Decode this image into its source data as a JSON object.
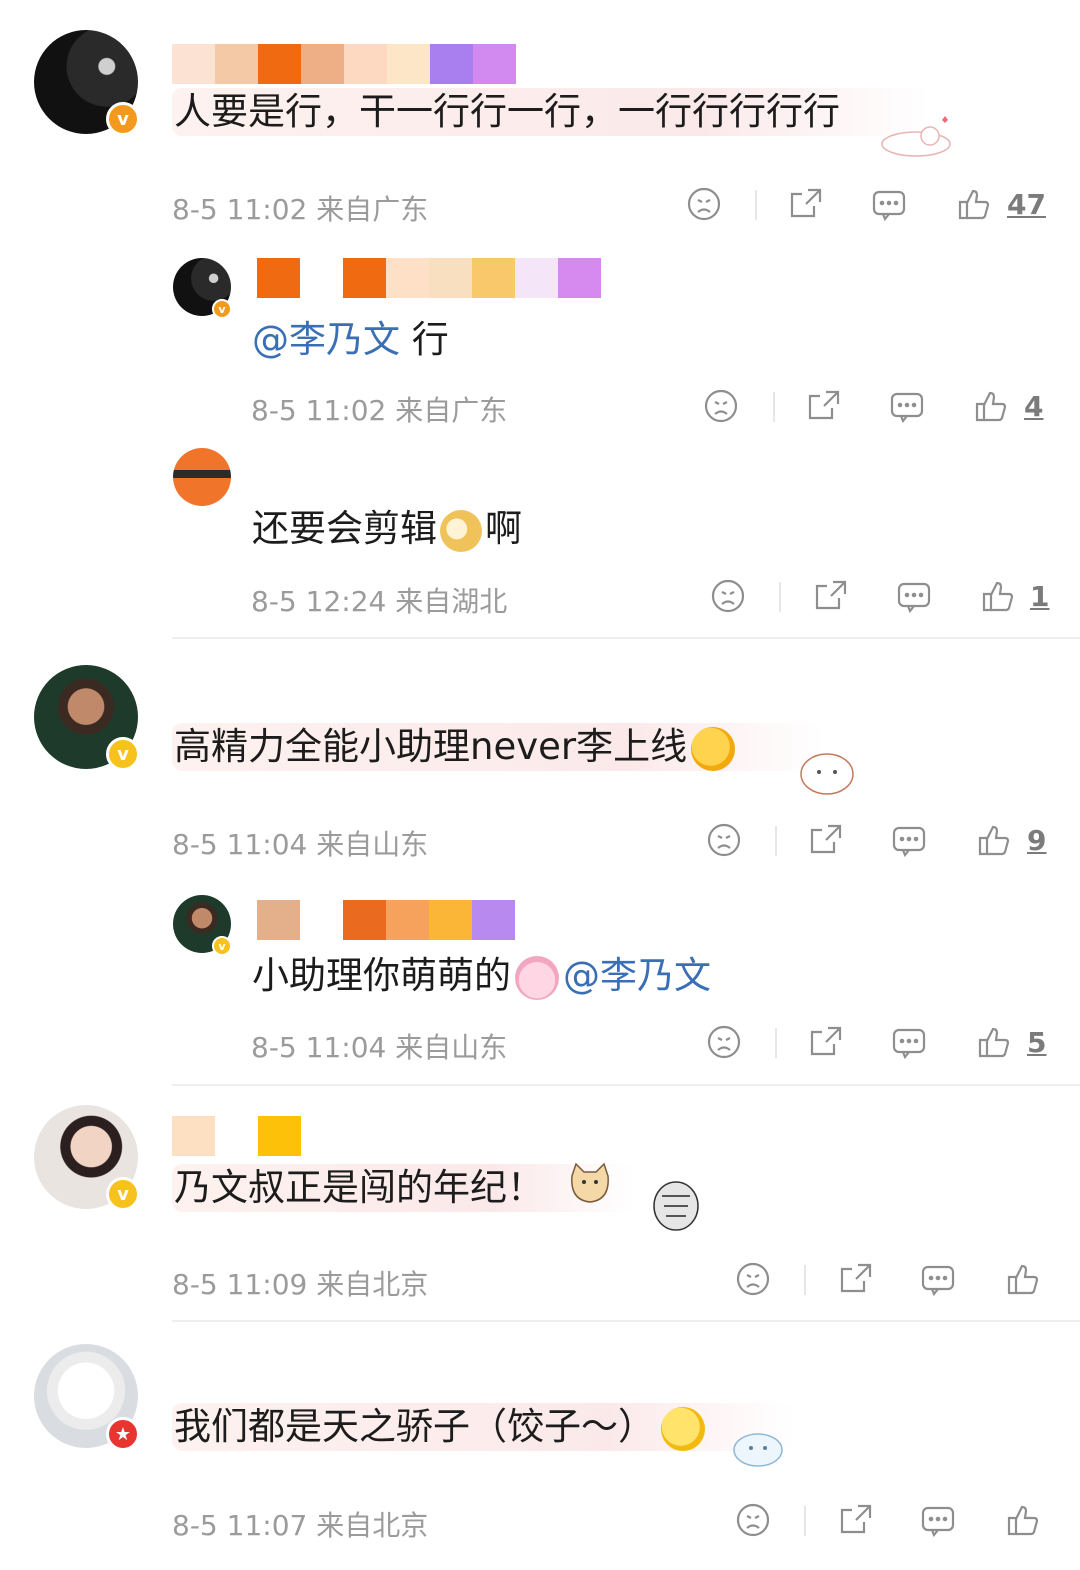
{
  "comments": [
    {
      "text": "人要是行，干一行行一行，一行行行行行",
      "meta": "8-5 11:02 来自广东",
      "likes": "47",
      "reply": {
        "mention": "@李乃文",
        "text": " 行",
        "meta": "8-5 11:02 来自广东",
        "likes": "4"
      }
    },
    {
      "reply2": {
        "text_a": "还要会剪辑",
        "text_b": "啊",
        "meta": "8-5 12:24 来自湖北",
        "likes": "1"
      }
    },
    {
      "text": "高精力全能小助理never李上线",
      "meta": "8-5 11:04 来自山东",
      "likes": "9",
      "reply": {
        "text": "小助理你萌萌的",
        "mention": "@李乃文",
        "meta": "8-5 11:04 来自山东",
        "likes": "5"
      }
    },
    {
      "text": "乃文叔正是闯的年纪！",
      "meta": "8-5 11:09 来自北京"
    },
    {
      "text": "我们都是天之骄子（饺子～）",
      "meta": "8-5 11:07 来自北京"
    }
  ],
  "badge_letter": "v",
  "icons": [
    "frown-icon",
    "share-icon",
    "comment-icon",
    "like-icon"
  ]
}
